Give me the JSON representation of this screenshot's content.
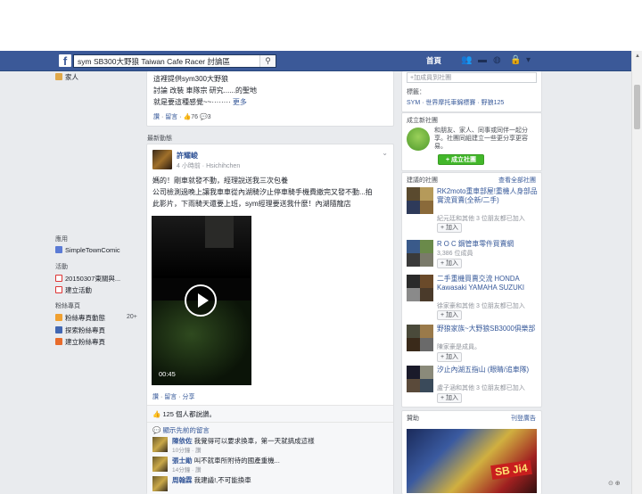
{
  "topbar": {
    "search_value": "sym SB300大野狼   Taiwan Cafe Racer 討論區",
    "home_label": "首頁"
  },
  "left_nav": {
    "family_label": "家人",
    "apps_heading": "應用",
    "app_item": "SimpleTownComic",
    "events_heading": "活動",
    "event_item": "20150307東關與...",
    "create_event": "建立活動",
    "pages_heading": "粉絲專頁",
    "pages_feed": "粉絲專頁動態",
    "pages_feed_count": "20+",
    "discover_pages": "探索粉絲專頁",
    "create_page": "建立粉絲專頁"
  },
  "top_post": {
    "line1": "這裡提供sym300大野狼",
    "line2": "討論 改裝 車隊宗 研究......的聖地",
    "line3": "就是要這種感覺~~········",
    "more": "更多",
    "like": "讚",
    "comment": "留言",
    "like_count": "76",
    "comment_count": "3"
  },
  "recent_label": "最新動態",
  "post": {
    "author": "許耀峻",
    "time": "4 小時前",
    "via": "Hsichihchen",
    "text_line1": "媽的！剛車就發不動，經理說送我三次包養",
    "text_line2": "公司檢測過晚上讓我車車從內湖騎汐止停車騎手機費繳完又發不動...拍",
    "text_line3": "此影片，下雨騎天還要上班，sym經理要送我什麼！內湖隨龍店",
    "video_time": "00:45",
    "like": "讚",
    "comment": "留言",
    "share": "分享",
    "likes_summary": "125 個人都說讚。",
    "view_prev": "顯示先前的留言",
    "comments": [
      {
        "name": "陳依佐",
        "text": "我覺得可以要求換車，第一天就搞成這樣",
        "meta": "10分鐘 · 讚"
      },
      {
        "name": "張士勛",
        "text": "叫不就車所附待的國產重機...",
        "meta": "14分鐘 · 讚"
      },
      {
        "name": "周翰霖",
        "text": "我建議!,不可能換車",
        "meta": ""
      }
    ]
  },
  "right": {
    "add_member_placeholder": "+加成員到社團",
    "tags_label": "標籤：",
    "tags_value": "SYM · 世界摩托車錦標賽 · 野狼125",
    "create_group_heading": "成立新社團",
    "create_group_text": "和朋友、家人、同事或同伴一起分享。社團同組建立一些更分享更容易。",
    "create_group_button": "成立社團",
    "suggested_heading": "建議的社團",
    "see_all": "查看全部社團",
    "groups": [
      {
        "name": "RK2moto重車部屋!重機人身部品實流買賣(全新/二手)",
        "sub": "紀元廷和其他 3 位朋友都已加入",
        "join": "加入"
      },
      {
        "name": "R O C 鋼管車零件買賣網",
        "sub": "3,386 位成員",
        "join": "加入"
      },
      {
        "name": "二手重機買賣交流 HONDA Kawasaki YAMAHA SUZUKI",
        "sub": "徐家豪和其他 3 位朋友都已加入",
        "join": "加入"
      },
      {
        "name": "野狼家族~大野狼SB3000俱樂部",
        "sub": "陳家豪是成員。",
        "join": "加入"
      },
      {
        "name": "汐止內湖五指山 (眼睛/追車隊)",
        "sub": "盧子涵和其他 3 位朋友都已加入",
        "join": "加入"
      }
    ],
    "sponsored_heading": "贊助",
    "create_ad": "刊登廣告",
    "ad_text": "SB Ji4"
  },
  "colors": {
    "bluebar": "#3b5998",
    "link": "#365899",
    "green_button": "#42b72a"
  }
}
